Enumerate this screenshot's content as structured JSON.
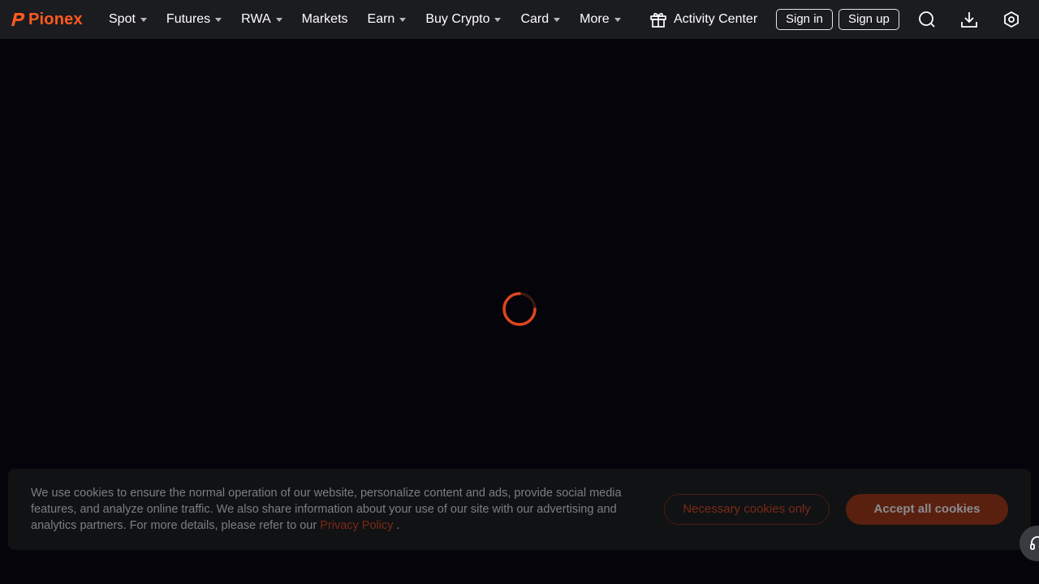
{
  "brand": {
    "name": "Pionex",
    "accent_color": "#ff5a1f"
  },
  "nav": {
    "items": [
      {
        "label": "Spot",
        "has_dropdown": true
      },
      {
        "label": "Futures",
        "has_dropdown": true
      },
      {
        "label": "RWA",
        "has_dropdown": true
      },
      {
        "label": "Markets",
        "has_dropdown": false
      },
      {
        "label": "Earn",
        "has_dropdown": true
      },
      {
        "label": "Buy Crypto",
        "has_dropdown": true
      },
      {
        "label": "Card",
        "has_dropdown": true
      },
      {
        "label": "More",
        "has_dropdown": true
      }
    ],
    "activity_center": {
      "label": "Activity Center",
      "icon": "gift-icon"
    },
    "sign_in": "Sign in",
    "sign_up": "Sign up",
    "icons": [
      "search-icon",
      "download-icon",
      "settings-icon"
    ]
  },
  "main": {
    "loading_indicator": "spinner-icon"
  },
  "cookie_banner": {
    "text_before_link": "We use cookies to ensure the normal operation of our website, personalize content and ads, provide social media features, and analyze online traffic. We also share information about your use of our site with our advertising and analytics partners. For more details, please refer to our",
    "link_text": "Privacy Policy",
    "text_after_link": ".",
    "necessary_label": "Necessary cookies only",
    "accept_label": "Accept all cookies"
  },
  "support": {
    "icon": "headset-icon"
  }
}
